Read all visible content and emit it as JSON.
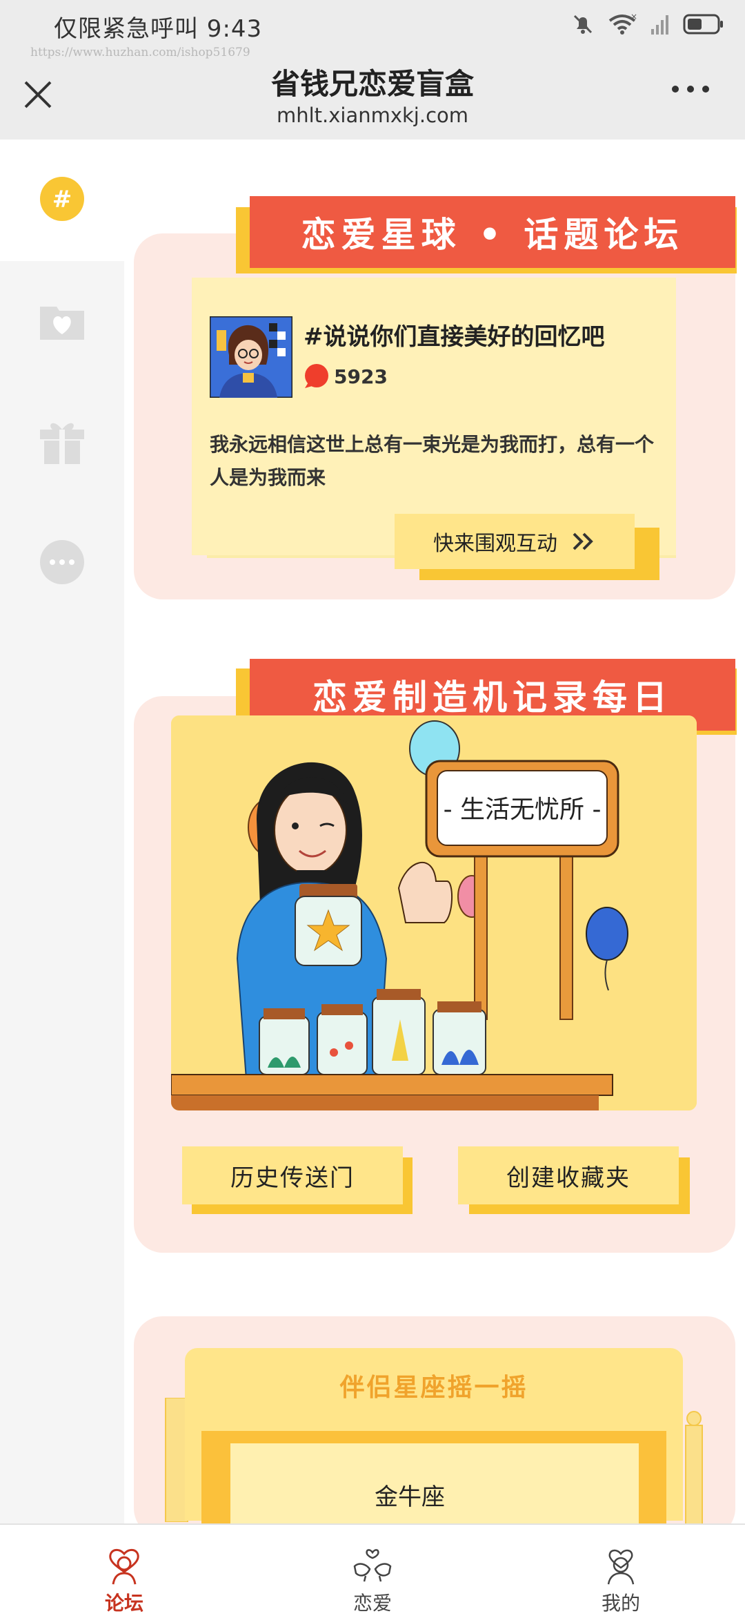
{
  "status_bar": {
    "text": "仅限紧急呼叫 9:43",
    "icons": [
      "bell-muted-icon",
      "wifi-icon",
      "signal-icon",
      "battery-icon"
    ]
  },
  "watermark": "https://www.huzhan.com/ishop51679",
  "header": {
    "title": "省钱兄恋爱盲盒",
    "url": "mhlt.xianmxkj.com",
    "close_icon": "close-icon",
    "more_icon": "more-icon"
  },
  "sidebar": {
    "items": [
      {
        "icon": "hashtag-icon",
        "active": true
      },
      {
        "icon": "heart-folder-icon",
        "active": false
      },
      {
        "icon": "gift-icon",
        "active": false
      },
      {
        "icon": "chat-bubble-icon",
        "active": false
      }
    ]
  },
  "forum_card": {
    "banner": "恋爱星球 • 话题论坛",
    "topic_title": "#说说你们直接美好的回忆吧",
    "comment_count": "5923",
    "body": "我永远相信这世上总有一束光是为我而打，总有一个人是为我而来",
    "join_label": "快来围观互动"
  },
  "maker_card": {
    "banner": "恋爱制造机记录每日",
    "sign_text": "- 生活无忧所 -",
    "history_label": "历史传送门",
    "favorites_label": "创建收藏夹"
  },
  "zodiac_card": {
    "title": "伴侣星座摇一摇",
    "value": "金牛座"
  },
  "tabbar": {
    "tabs": [
      {
        "label": "论坛",
        "icon": "forum-couple-icon",
        "active": true
      },
      {
        "label": "恋爱",
        "icon": "love-birds-icon",
        "active": false
      },
      {
        "label": "我的",
        "icon": "profile-icon",
        "active": false
      }
    ]
  },
  "colors": {
    "accent_red": "#ef5a42",
    "accent_yellow": "#f9c634",
    "card_pink": "#fde9e3",
    "pale_yellow": "#fff1b8",
    "tab_active": "#c7331f"
  }
}
